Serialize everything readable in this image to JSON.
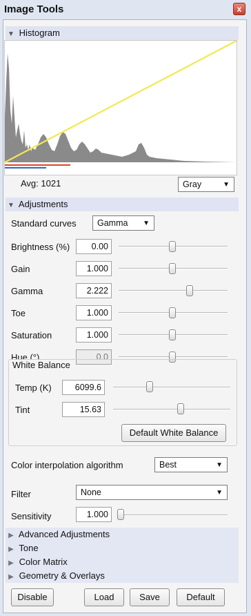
{
  "window": {
    "title": "Image Tools",
    "close_glyph": "x"
  },
  "histogram": {
    "header": "Histogram",
    "avg_label": "Avg: 1021",
    "channel": "Gray"
  },
  "adjustments": {
    "header": "Adjustments",
    "standard_curves_label": "Standard curves",
    "standard_curves_value": "Gamma",
    "sliders": [
      {
        "label": "Brightness (%)",
        "value": "0.00",
        "level": 0.49,
        "disabled": false
      },
      {
        "label": "Gain",
        "value": "1.000",
        "level": 0.49,
        "disabled": false
      },
      {
        "label": "Gamma",
        "value": "2.222",
        "level": 0.66,
        "disabled": false
      },
      {
        "label": "Toe",
        "value": "1.000",
        "level": 0.49,
        "disabled": false
      },
      {
        "label": "Saturation",
        "value": "1.000",
        "level": 0.49,
        "disabled": false
      },
      {
        "label": "Hue (°)",
        "value": "0.0",
        "level": 0.49,
        "disabled": true
      }
    ],
    "white_balance": {
      "title": "White Balance",
      "temp_label": "Temp (K)",
      "temp_value": "6099.6",
      "temp_level": 0.3,
      "tint_label": "Tint",
      "tint_value": "15.63",
      "tint_level": 0.58,
      "default_button": "Default White Balance"
    },
    "color_interp_label": "Color interpolation algorithm",
    "color_interp_value": "Best",
    "filter_label": "Filter",
    "filter_value": "None",
    "sensitivity_label": "Sensitivity",
    "sensitivity_value": "1.000",
    "sensitivity_level": 0.0
  },
  "collapsed_sections": [
    "Advanced Adjustments",
    "Tone",
    "Color Matrix",
    "Geometry & Overlays"
  ],
  "buttons": {
    "disable": "Disable",
    "load": "Load",
    "save": "Save",
    "default": "Default"
  },
  "colors": {
    "curve": "#f2e94e",
    "histogram_fill": "#8a8a8a",
    "accent_red": "#d9452c",
    "accent_blue": "#3565c8"
  },
  "icons": {
    "collapse": "triangle-down-icon",
    "expand": "triangle-right-icon",
    "dropdown": "chevron-down-icon"
  }
}
